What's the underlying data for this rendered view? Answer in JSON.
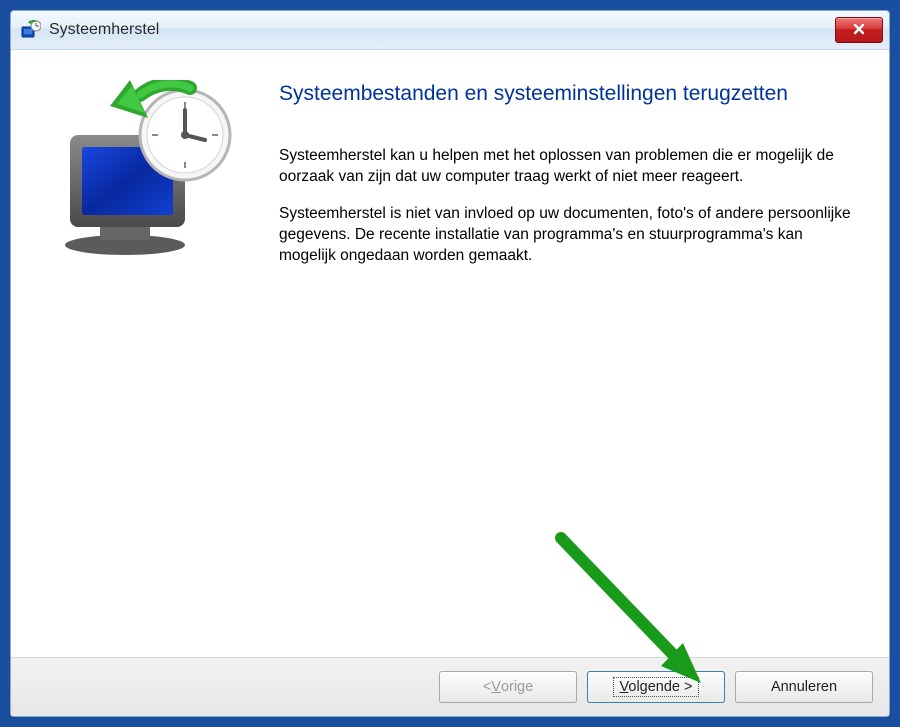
{
  "window": {
    "title": "Systeemherstel"
  },
  "content": {
    "heading": "Systeembestanden en systeeminstellingen terugzetten",
    "paragraph1": "Systeemherstel kan u helpen met het oplossen van problemen die er mogelijk de oorzaak van zijn dat uw computer traag werkt of niet meer reageert.",
    "paragraph2": "Systeemherstel is niet van invloed op uw documenten, foto's of andere persoonlijke gegevens. De recente installatie van programma's en stuurprogramma's kan mogelijk ongedaan worden gemaakt."
  },
  "footer": {
    "back_prefix": "< ",
    "back_mnemonic": "V",
    "back_rest": "orige",
    "next_mnemonic": "V",
    "next_rest": "olgende >",
    "cancel_label": "Annuleren"
  }
}
